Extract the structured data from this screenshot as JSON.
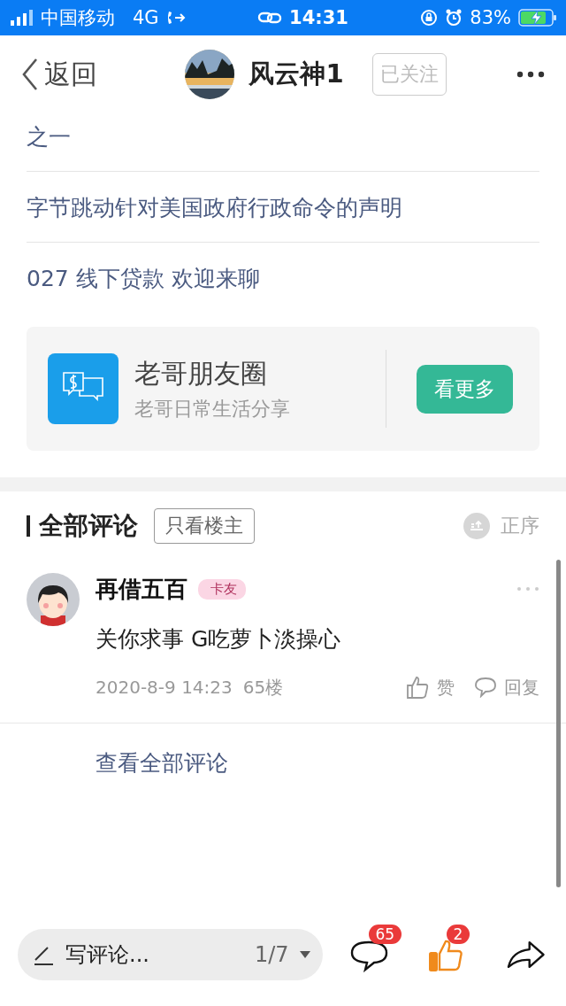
{
  "status_bar": {
    "carrier": "中国移动",
    "network": "4G",
    "time": "14:31",
    "battery": "83%",
    "charging": true
  },
  "header": {
    "back": "返回",
    "author": "风云神1",
    "follow": "已关注",
    "following": true
  },
  "related_links": [
    "之一",
    "字节跳动针对美国政府行政命令的声明",
    "027 线下贷款 欢迎来聊"
  ],
  "promo_card": {
    "title": "老哥朋友圈",
    "subtitle": "老哥日常生活分享",
    "button": "看更多"
  },
  "comments_header": {
    "title": "全部评论",
    "filter": "只看楼主",
    "sort": "正序"
  },
  "comments": [
    {
      "user": "再借五百",
      "badge": "卡友",
      "text": "关你求事 G吃萝卜淡操心",
      "time": "2020-8-9 14:23",
      "floor": "65楼",
      "like": "赞",
      "reply": "回复"
    }
  ],
  "view_all": "查看全部评论",
  "bottom_bar": {
    "placeholder": "写评论...",
    "page": "1/7",
    "comment_count": "65",
    "like_count": "2",
    "liked": true
  }
}
